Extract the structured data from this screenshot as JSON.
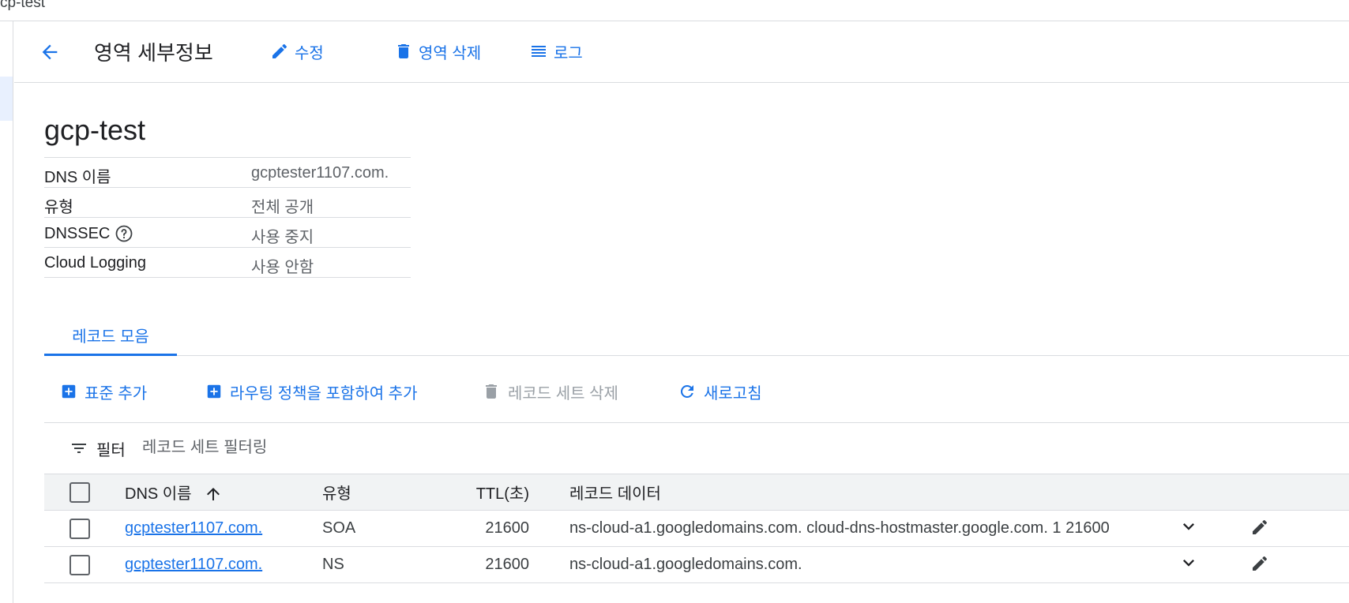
{
  "breadcrumb": {
    "text": "cp-test"
  },
  "header": {
    "title": "영역 세부정보",
    "edit_label": "수정",
    "delete_zone_label": "영역 삭제",
    "logs_label": "로그"
  },
  "zone": {
    "name": "gcp-test",
    "details": [
      {
        "key": "DNS 이름",
        "value": "gcptester1107.com."
      },
      {
        "key": "유형",
        "value": "전체 공개"
      },
      {
        "key": "DNSSEC",
        "value": "사용 중지"
      },
      {
        "key": "Cloud Logging",
        "value": "사용 안함"
      }
    ]
  },
  "tabs": [
    {
      "label": "레코드 모음",
      "active": true
    }
  ],
  "toolbar": {
    "add_standard_label": "표준 추가",
    "add_with_routing_label": "라우팅 정책을 포함하여 추가",
    "delete_recordset_label": "레코드 세트 삭제",
    "refresh_label": "새로고침"
  },
  "filter": {
    "label": "필터",
    "placeholder": "레코드 세트 필터링"
  },
  "table": {
    "columns": {
      "dns_name": "DNS 이름",
      "type": "유형",
      "ttl": "TTL(초)",
      "data": "레코드 데이터"
    },
    "rows": [
      {
        "dns_name": "gcptester1107.com.",
        "type": "SOA",
        "ttl": "21600",
        "data": "ns-cloud-a1.googledomains.com. cloud-dns-hostmaster.google.com. 1 21600"
      },
      {
        "dns_name": "gcptester1107.com.",
        "type": "NS",
        "ttl": "21600",
        "data": "ns-cloud-a1.googledomains.com."
      }
    ]
  },
  "colors": {
    "accent": "#1a73e8",
    "text": "#202124",
    "muted": "#5f6368",
    "divider": "#dadce0",
    "header_bg": "#f1f3f4"
  }
}
